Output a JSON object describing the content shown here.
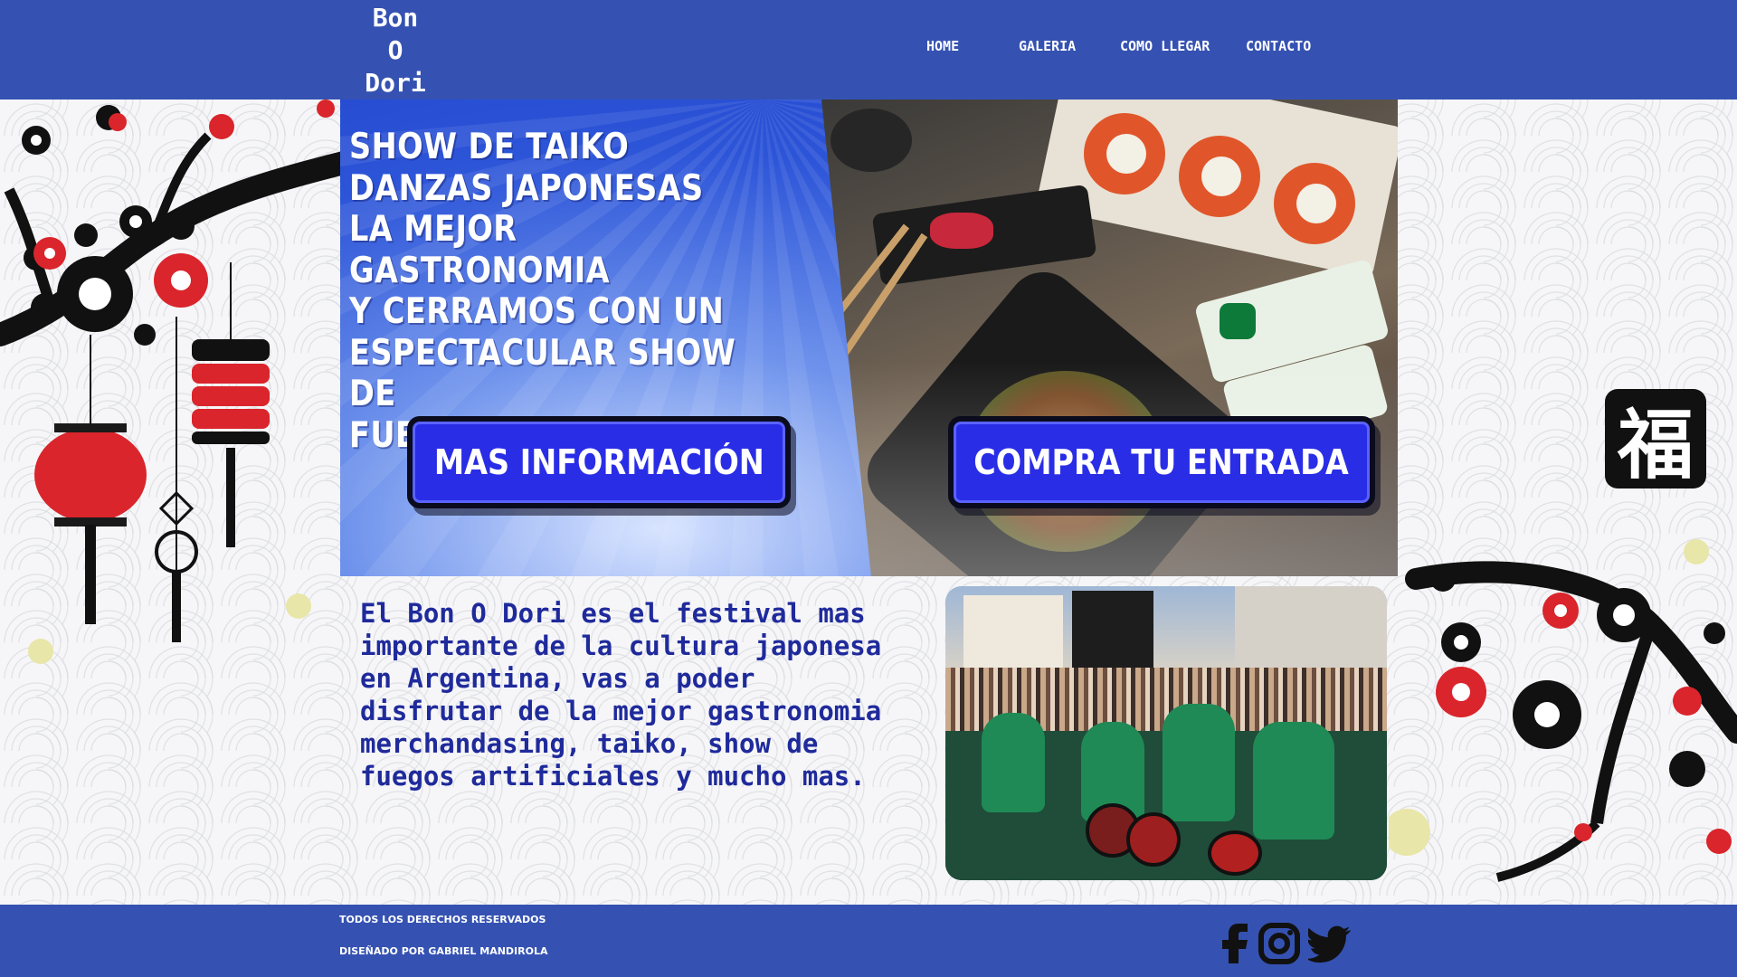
{
  "header": {
    "logo": "Bon\nO\nDori",
    "nav": [
      {
        "label": "HOME"
      },
      {
        "label": "GALERIA"
      },
      {
        "label": "COMO LLEGAR"
      },
      {
        "label": "CONTACTO"
      }
    ]
  },
  "hero": {
    "title": "Show de Taiko\nDanzas Japonesas\nLa mejor gastronomia\nY cerramos con un\nespectacular show de\nfuegos artificiales",
    "more_info_button": "Mas Información",
    "buy_ticket_button": "Compra tu entrada"
  },
  "content": {
    "intro": "El Bon O Dori es el festival mas importante de la cultura japonesa en Argentina, vas a poder disfrutar de la mejor gastronomia merchandasing, taiko, show de fuegos artificiales y mucho mas."
  },
  "decor": {
    "kanji": "福"
  },
  "footer": {
    "rights": "Todos los derechos reservados",
    "designed_by": "Diseñado por Gabriel Mandirola"
  },
  "social": [
    {
      "icon": "facebook-icon"
    },
    {
      "icon": "instagram-icon"
    },
    {
      "icon": "twitter-icon"
    }
  ],
  "colors": {
    "header_bg": "#3552b2",
    "button_bg": "#2a2de6",
    "intro_text": "#1f2a9b"
  }
}
